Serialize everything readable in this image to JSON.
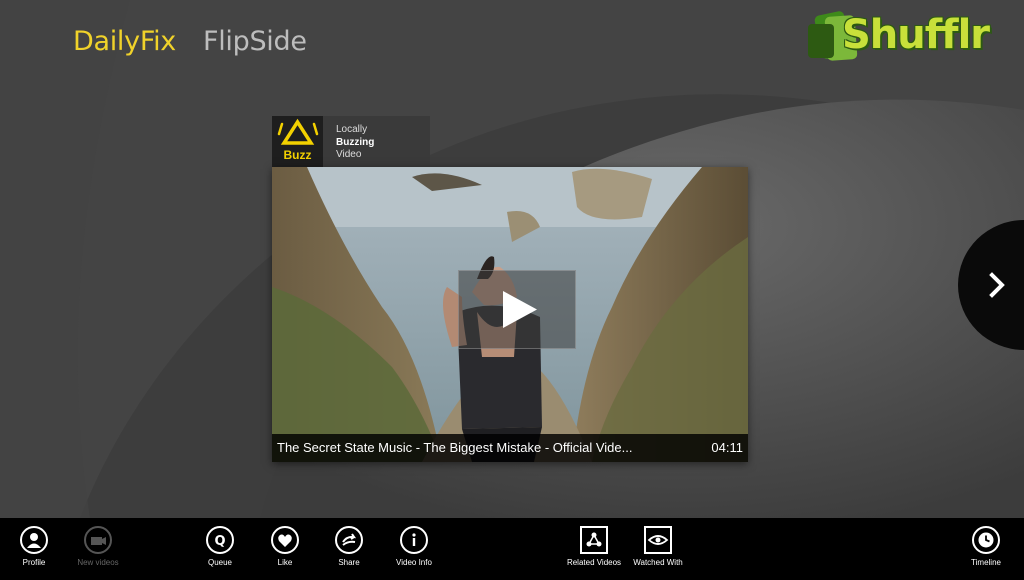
{
  "header": {
    "tabs": [
      {
        "label": "DailyFix",
        "color": "#f0d22a",
        "active": true
      },
      {
        "label": "FlipSide",
        "color": "#bdbdbd",
        "active": false
      }
    ],
    "logo_text": "Shufflr",
    "logo_colors": [
      "#7cb83a",
      "#3e8a1a",
      "#c8e03a"
    ]
  },
  "card": {
    "badge_label": "Buzz",
    "category_lines": [
      "Locally",
      "Buzzing",
      "Video"
    ],
    "video_title": "The Secret State Music - The Biggest Mistake - Official Vide...",
    "duration": "04:11",
    "accent_color": "#f3d100"
  },
  "appbar": {
    "left": [
      {
        "label": "Profile",
        "icon": "person-icon"
      },
      {
        "label": "New videos",
        "icon": "camera-icon",
        "disabled": true
      },
      {
        "label": "Queue",
        "icon": "queue-icon"
      },
      {
        "label": "Like",
        "icon": "heart-icon"
      },
      {
        "label": "Share",
        "icon": "share-icon"
      },
      {
        "label": "Video Info",
        "icon": "info-icon"
      }
    ],
    "right": [
      {
        "label": "Related Videos",
        "icon": "related-icon"
      },
      {
        "label": "Watched With",
        "icon": "eye-icon"
      },
      {
        "label": "Timeline",
        "icon": "clock-icon"
      }
    ]
  }
}
